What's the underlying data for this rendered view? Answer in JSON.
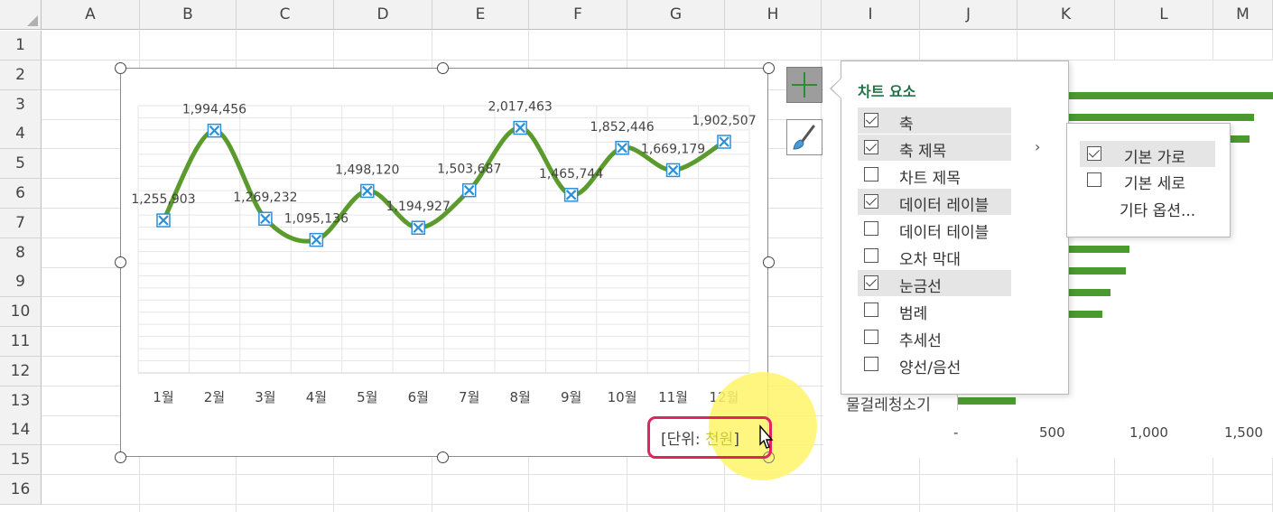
{
  "columns": [
    "A",
    "B",
    "C",
    "D",
    "E",
    "F",
    "G",
    "H",
    "I",
    "J",
    "K",
    "L",
    "M"
  ],
  "rows": [
    "1",
    "2",
    "3",
    "4",
    "5",
    "6",
    "7",
    "8",
    "9",
    "10",
    "11",
    "12",
    "13",
    "14",
    "15",
    "16"
  ],
  "chart_data": {
    "type": "line",
    "categories": [
      "1월",
      "2월",
      "3월",
      "4월",
      "5월",
      "6월",
      "7월",
      "8월",
      "9월",
      "10월",
      "11월",
      "12월"
    ],
    "values": [
      1255903,
      1994456,
      1269232,
      1095136,
      1498120,
      1194927,
      1503687,
      2017463,
      1465744,
      1852446,
      1669179,
      1902507
    ],
    "data_labels": [
      "1,255,903",
      "1,994,456",
      "1,269,232",
      "1,095,136",
      "1,498,120",
      "1,194,927",
      "1,503,687",
      "2,017,463",
      "1,465,744",
      "1,852,446",
      "1,669,179",
      "1,902,507"
    ],
    "line_color": "#5b9b2e",
    "marker_color": "#2e8fd6",
    "smooth": true,
    "grid": true,
    "ylim": [
      0,
      2200000
    ],
    "unit_prefix": "[단위: ",
    "unit_value": "천원",
    "unit_suffix": "]"
  },
  "side_buttons": {
    "add_icon": "plus-icon",
    "style_icon": "brush-icon"
  },
  "chart_elements_panel": {
    "title": "차트 요소",
    "items": [
      {
        "label": "축",
        "checked": true
      },
      {
        "label": "축 제목",
        "checked": true,
        "has_submenu": true
      },
      {
        "label": "차트 제목",
        "checked": false
      },
      {
        "label": "데이터 레이블",
        "checked": true
      },
      {
        "label": "데이터 테이블",
        "checked": false
      },
      {
        "label": "오차 막대",
        "checked": false
      },
      {
        "label": "눈금선",
        "checked": true
      },
      {
        "label": "범례",
        "checked": false
      },
      {
        "label": "추세선",
        "checked": false
      },
      {
        "label": "양선/음선",
        "checked": false
      }
    ],
    "submenu": {
      "items": [
        {
          "label": "기본 가로",
          "checked": true
        },
        {
          "label": "기본 세로",
          "checked": false
        }
      ],
      "more_options": "기타 옵션..."
    }
  },
  "background_chart": {
    "visible_label": "물걸레청소기",
    "axis_ticks": [
      "-",
      "500",
      "1,000",
      "1,500"
    ]
  },
  "colors": {
    "accent": "#217346",
    "highlight_box": "#e0245e",
    "cursor_glow": "#fff46a"
  }
}
